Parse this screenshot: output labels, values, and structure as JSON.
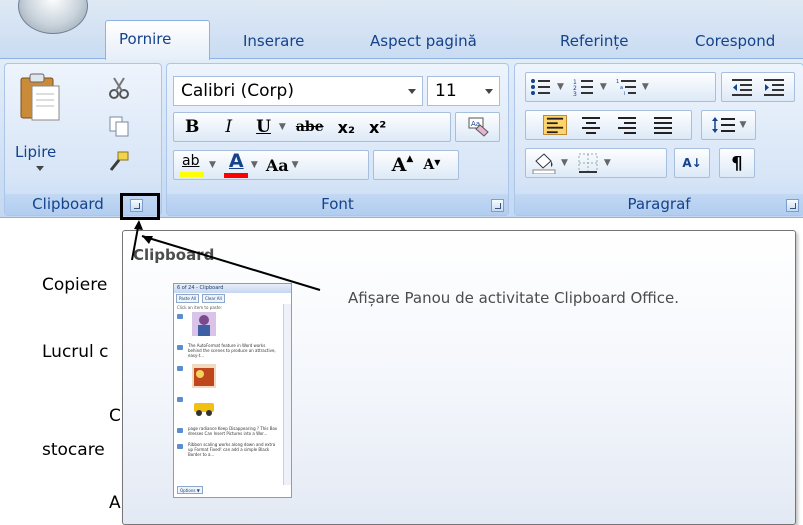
{
  "tabs": {
    "pornire": "Pornire",
    "inserare": "Inserare",
    "aspect": "Aspect pagină",
    "referinte": "Referințe",
    "corespond": "Corespond"
  },
  "clipboard": {
    "paste_label": "Lipire",
    "group_label": "Clipboard"
  },
  "font": {
    "font_name": "Calibri (Corp)",
    "font_size": "11",
    "bold": "B",
    "italic": "I",
    "underline": "U",
    "strike": "abe",
    "subscript": "x₂",
    "superscript": "x²",
    "change_case": "Aa",
    "grow": "A",
    "shrink": "A",
    "color_a": "A",
    "highlight_ab": "ab",
    "group_label": "Font"
  },
  "paragraph": {
    "sort": "A↓",
    "pilcrow": "¶",
    "group_label": "Paragraf"
  },
  "document": {
    "lines": [
      "Copiere",
      "Lucrul c",
      "C",
      "stocare",
      "A"
    ]
  },
  "tooltip": {
    "title": "Clipboard",
    "description": "Afișare Panou de activitate Clipboard Office."
  },
  "pane": {
    "title": "6 of 24 - Clipboard",
    "paste_all": "Paste All",
    "clear_all": "Clear All",
    "hint": "Click an item to paste:",
    "item1": "The AutoFormat feature in Word works behind the scenes to produce an attractive, easy-t...",
    "item2": "page radiance Keep Disappearing ? This Box dresses Can Insert Pictures into a Wor...",
    "item3": "Ribbon scaling works along down and extra up Format Fixed! can add a simple Black Border to a...",
    "options": "Options ▼"
  },
  "colors": {
    "ribbon_text": "#15428b",
    "highlight_yellow": "#ffff00",
    "font_red": "#ff0000"
  }
}
